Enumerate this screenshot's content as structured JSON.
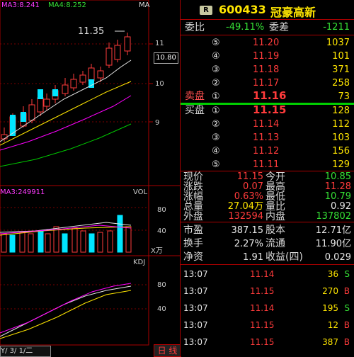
{
  "chart": {
    "indicator_top": {
      "ma3": "MA3:8.241",
      "ma4": "MA4:8.252",
      "ma_label": "MA"
    },
    "high_marker": "11.35",
    "price_axis": [
      "11",
      "10.80",
      "10",
      "9"
    ],
    "vol_header": {
      "ma3": "MA3:249911",
      "label": "VOL"
    },
    "vol_axis": [
      "80",
      "40",
      "X万"
    ],
    "kdj_header": {
      "label": "KDJ"
    },
    "kdj_axis": [
      "80",
      "40"
    ],
    "footer": {
      "scroll": "Y/ 3/ 1/二",
      "tab": "日 线"
    },
    "colors": {
      "up": "#ff3b3b",
      "down": "#00e5ff",
      "ma_white": "#e6e6e6",
      "ma_yellow": "#ffe600",
      "ma_magenta": "#ff00ff",
      "ma_green": "#00c800"
    }
  },
  "quote": {
    "badge": "R",
    "code": "600433",
    "name": "冠豪高新",
    "weibi_label": "委比",
    "weibi_value": "-49.11%",
    "weicha_label": "委差",
    "weicha_value": "-1211",
    "sell_label": "卖盘",
    "buy_label": "买盘",
    "asks": [
      {
        "level": "⑤",
        "price": "11.20",
        "vol": "1037"
      },
      {
        "level": "④",
        "price": "11.19",
        "vol": "101"
      },
      {
        "level": "③",
        "price": "11.18",
        "vol": "371"
      },
      {
        "level": "②",
        "price": "11.17",
        "vol": "258"
      },
      {
        "level": "①",
        "price": "11.16",
        "vol": "73"
      }
    ],
    "bids": [
      {
        "level": "①",
        "price": "11.15",
        "vol": "128"
      },
      {
        "level": "②",
        "price": "11.14",
        "vol": "112"
      },
      {
        "level": "③",
        "price": "11.13",
        "vol": "103"
      },
      {
        "level": "④",
        "price": "11.12",
        "vol": "156"
      },
      {
        "level": "⑤",
        "price": "11.11",
        "vol": "129"
      }
    ],
    "stats": [
      {
        "l1": "现价",
        "v1": "11.15",
        "l2": "今开",
        "v2": "10.85",
        "c1": "red",
        "c2": "green"
      },
      {
        "l1": "涨跌",
        "v1": "0.07",
        "l2": "最高",
        "v2": "11.28",
        "c1": "red",
        "c2": "red"
      },
      {
        "l1": "涨幅",
        "v1": "0.63%",
        "l2": "最低",
        "v2": "10.79",
        "c1": "red",
        "c2": "green"
      },
      {
        "l1": "总量",
        "v1": "27.04万",
        "l2": "量比",
        "v2": "0.92",
        "c1": "yellow",
        "c2": "white"
      },
      {
        "l1": "外盘",
        "v1": "132594",
        "l2": "内盘",
        "v2": "137802",
        "c1": "red",
        "c2": "green"
      }
    ],
    "fund": [
      {
        "l1": "市盈",
        "v1": "387.15",
        "l2": "股本",
        "v2": "12.71亿"
      },
      {
        "l1": "换手",
        "v1": "2.27%",
        "l2": "流通",
        "v2": "11.90亿"
      },
      {
        "l1": "净资",
        "v1": "1.91",
        "l2": "收益(四)",
        "v2": "0.029"
      }
    ],
    "ticks": [
      {
        "time": "13:07",
        "price": "11.14",
        "vol": "36",
        "side": "S"
      },
      {
        "time": "13:07",
        "price": "11.15",
        "vol": "270",
        "side": "B"
      },
      {
        "time": "13:07",
        "price": "11.14",
        "vol": "195",
        "side": "S"
      },
      {
        "time": "13:07",
        "price": "11.15",
        "vol": "12",
        "side": "B"
      },
      {
        "time": "13:07",
        "price": "11.15",
        "vol": "387",
        "side": "B"
      }
    ]
  }
}
